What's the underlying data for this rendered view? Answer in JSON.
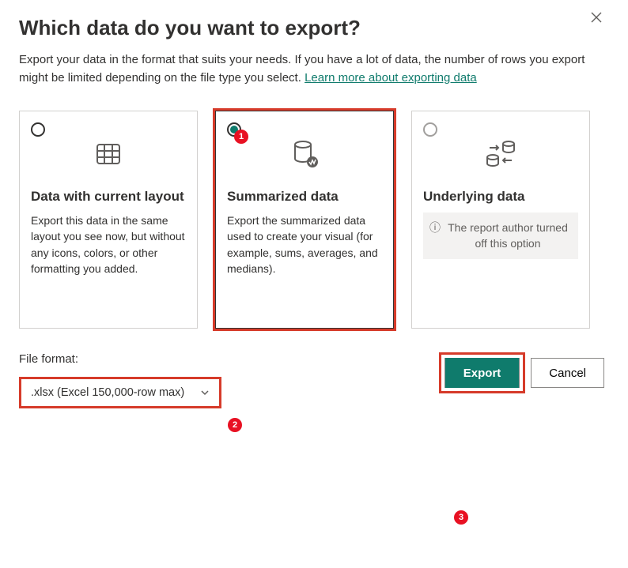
{
  "dialog": {
    "title": "Which data do you want to export?",
    "subtitle_prefix": "Export your data in the format that suits your needs. If you have a lot of data, the number of rows you export might be limited depending on the file type you select.  ",
    "learn_more": "Learn more about exporting data"
  },
  "options": {
    "current_layout": {
      "title": "Data with current layout",
      "desc": "Export this data in the same layout you see now, but without any icons, colors, or other formatting you added."
    },
    "summarized": {
      "title": "Summarized data",
      "desc": "Export the summarized data used to create your visual (for example, sums, averages, and medians)."
    },
    "underlying": {
      "title": "Underlying data",
      "disabled_note": "The report author turned off this option"
    }
  },
  "file_format": {
    "label": "File format:",
    "value": ".xlsx (Excel 150,000-row max)"
  },
  "buttons": {
    "export": "Export",
    "cancel": "Cancel"
  },
  "callouts": {
    "one": "1",
    "two": "2",
    "three": "3"
  }
}
